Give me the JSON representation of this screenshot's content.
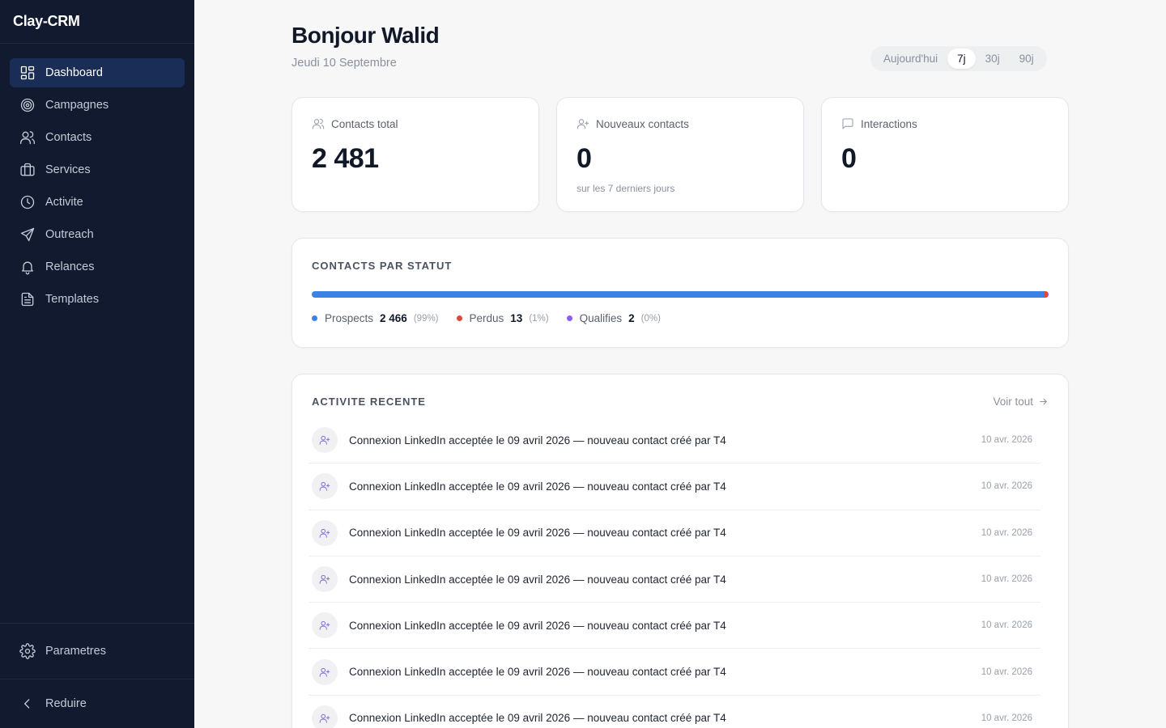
{
  "app": {
    "brand": "Clay-CRM"
  },
  "sidebar": {
    "items": [
      {
        "label": "Dashboard",
        "icon": "dashboard-icon",
        "active": true
      },
      {
        "label": "Campagnes",
        "icon": "target-icon"
      },
      {
        "label": "Contacts",
        "icon": "users-icon"
      },
      {
        "label": "Services",
        "icon": "briefcase-icon"
      },
      {
        "label": "Activite",
        "icon": "clock-icon"
      },
      {
        "label": "Outreach",
        "icon": "send-icon"
      },
      {
        "label": "Relances",
        "icon": "bell-icon"
      },
      {
        "label": "Templates",
        "icon": "file-icon"
      }
    ],
    "settings": "Parametres",
    "collapse": "Reduire"
  },
  "header": {
    "greeting": "Bonjour Walid",
    "date": "Jeudi 10 Septembre",
    "range": [
      "Aujourd'hui",
      "7j",
      "30j",
      "90j"
    ],
    "range_active": "7j"
  },
  "stats": [
    {
      "label": "Contacts total",
      "value": "2 481",
      "sub": "",
      "icon": "users-icon"
    },
    {
      "label": "Nouveaux contacts",
      "value": "0",
      "sub": "sur les 7 derniers jours",
      "icon": "user-plus-icon"
    },
    {
      "label": "Interactions",
      "value": "0",
      "sub": "",
      "icon": "message-icon"
    }
  ],
  "status": {
    "title": "CONTACTS PAR STATUT",
    "segments": [
      {
        "name": "Prospects",
        "count": "2 466",
        "pct": "(99%)",
        "value": 2466,
        "color": "#3b82e6"
      },
      {
        "name": "Perdus",
        "count": "13",
        "pct": "(1%)",
        "value": 13,
        "color": "#e0483e"
      },
      {
        "name": "Qualifies",
        "count": "2",
        "pct": "(0%)",
        "value": 2,
        "color": "#8b5cf6"
      }
    ]
  },
  "activity": {
    "title": "ACTIVITE RECENTE",
    "see_all": "Voir tout",
    "rows": [
      {
        "text": "Connexion LinkedIn acceptée le 09 avril 2026 — nouveau contact créé par T4",
        "time": "10 avr. 2026"
      },
      {
        "text": "Connexion LinkedIn acceptée le 09 avril 2026 — nouveau contact créé par T4",
        "time": "10 avr. 2026"
      },
      {
        "text": "Connexion LinkedIn acceptée le 09 avril 2026 — nouveau contact créé par T4",
        "time": "10 avr. 2026"
      },
      {
        "text": "Connexion LinkedIn acceptée le 09 avril 2026 — nouveau contact créé par T4",
        "time": "10 avr. 2026"
      },
      {
        "text": "Connexion LinkedIn acceptée le 09 avril 2026 — nouveau contact créé par T4",
        "time": "10 avr. 2026"
      },
      {
        "text": "Connexion LinkedIn acceptée le 09 avril 2026 — nouveau contact créé par T4",
        "time": "10 avr. 2026"
      },
      {
        "text": "Connexion LinkedIn acceptée le 09 avril 2026 — nouveau contact créé par T4",
        "time": "10 avr. 2026"
      }
    ]
  }
}
